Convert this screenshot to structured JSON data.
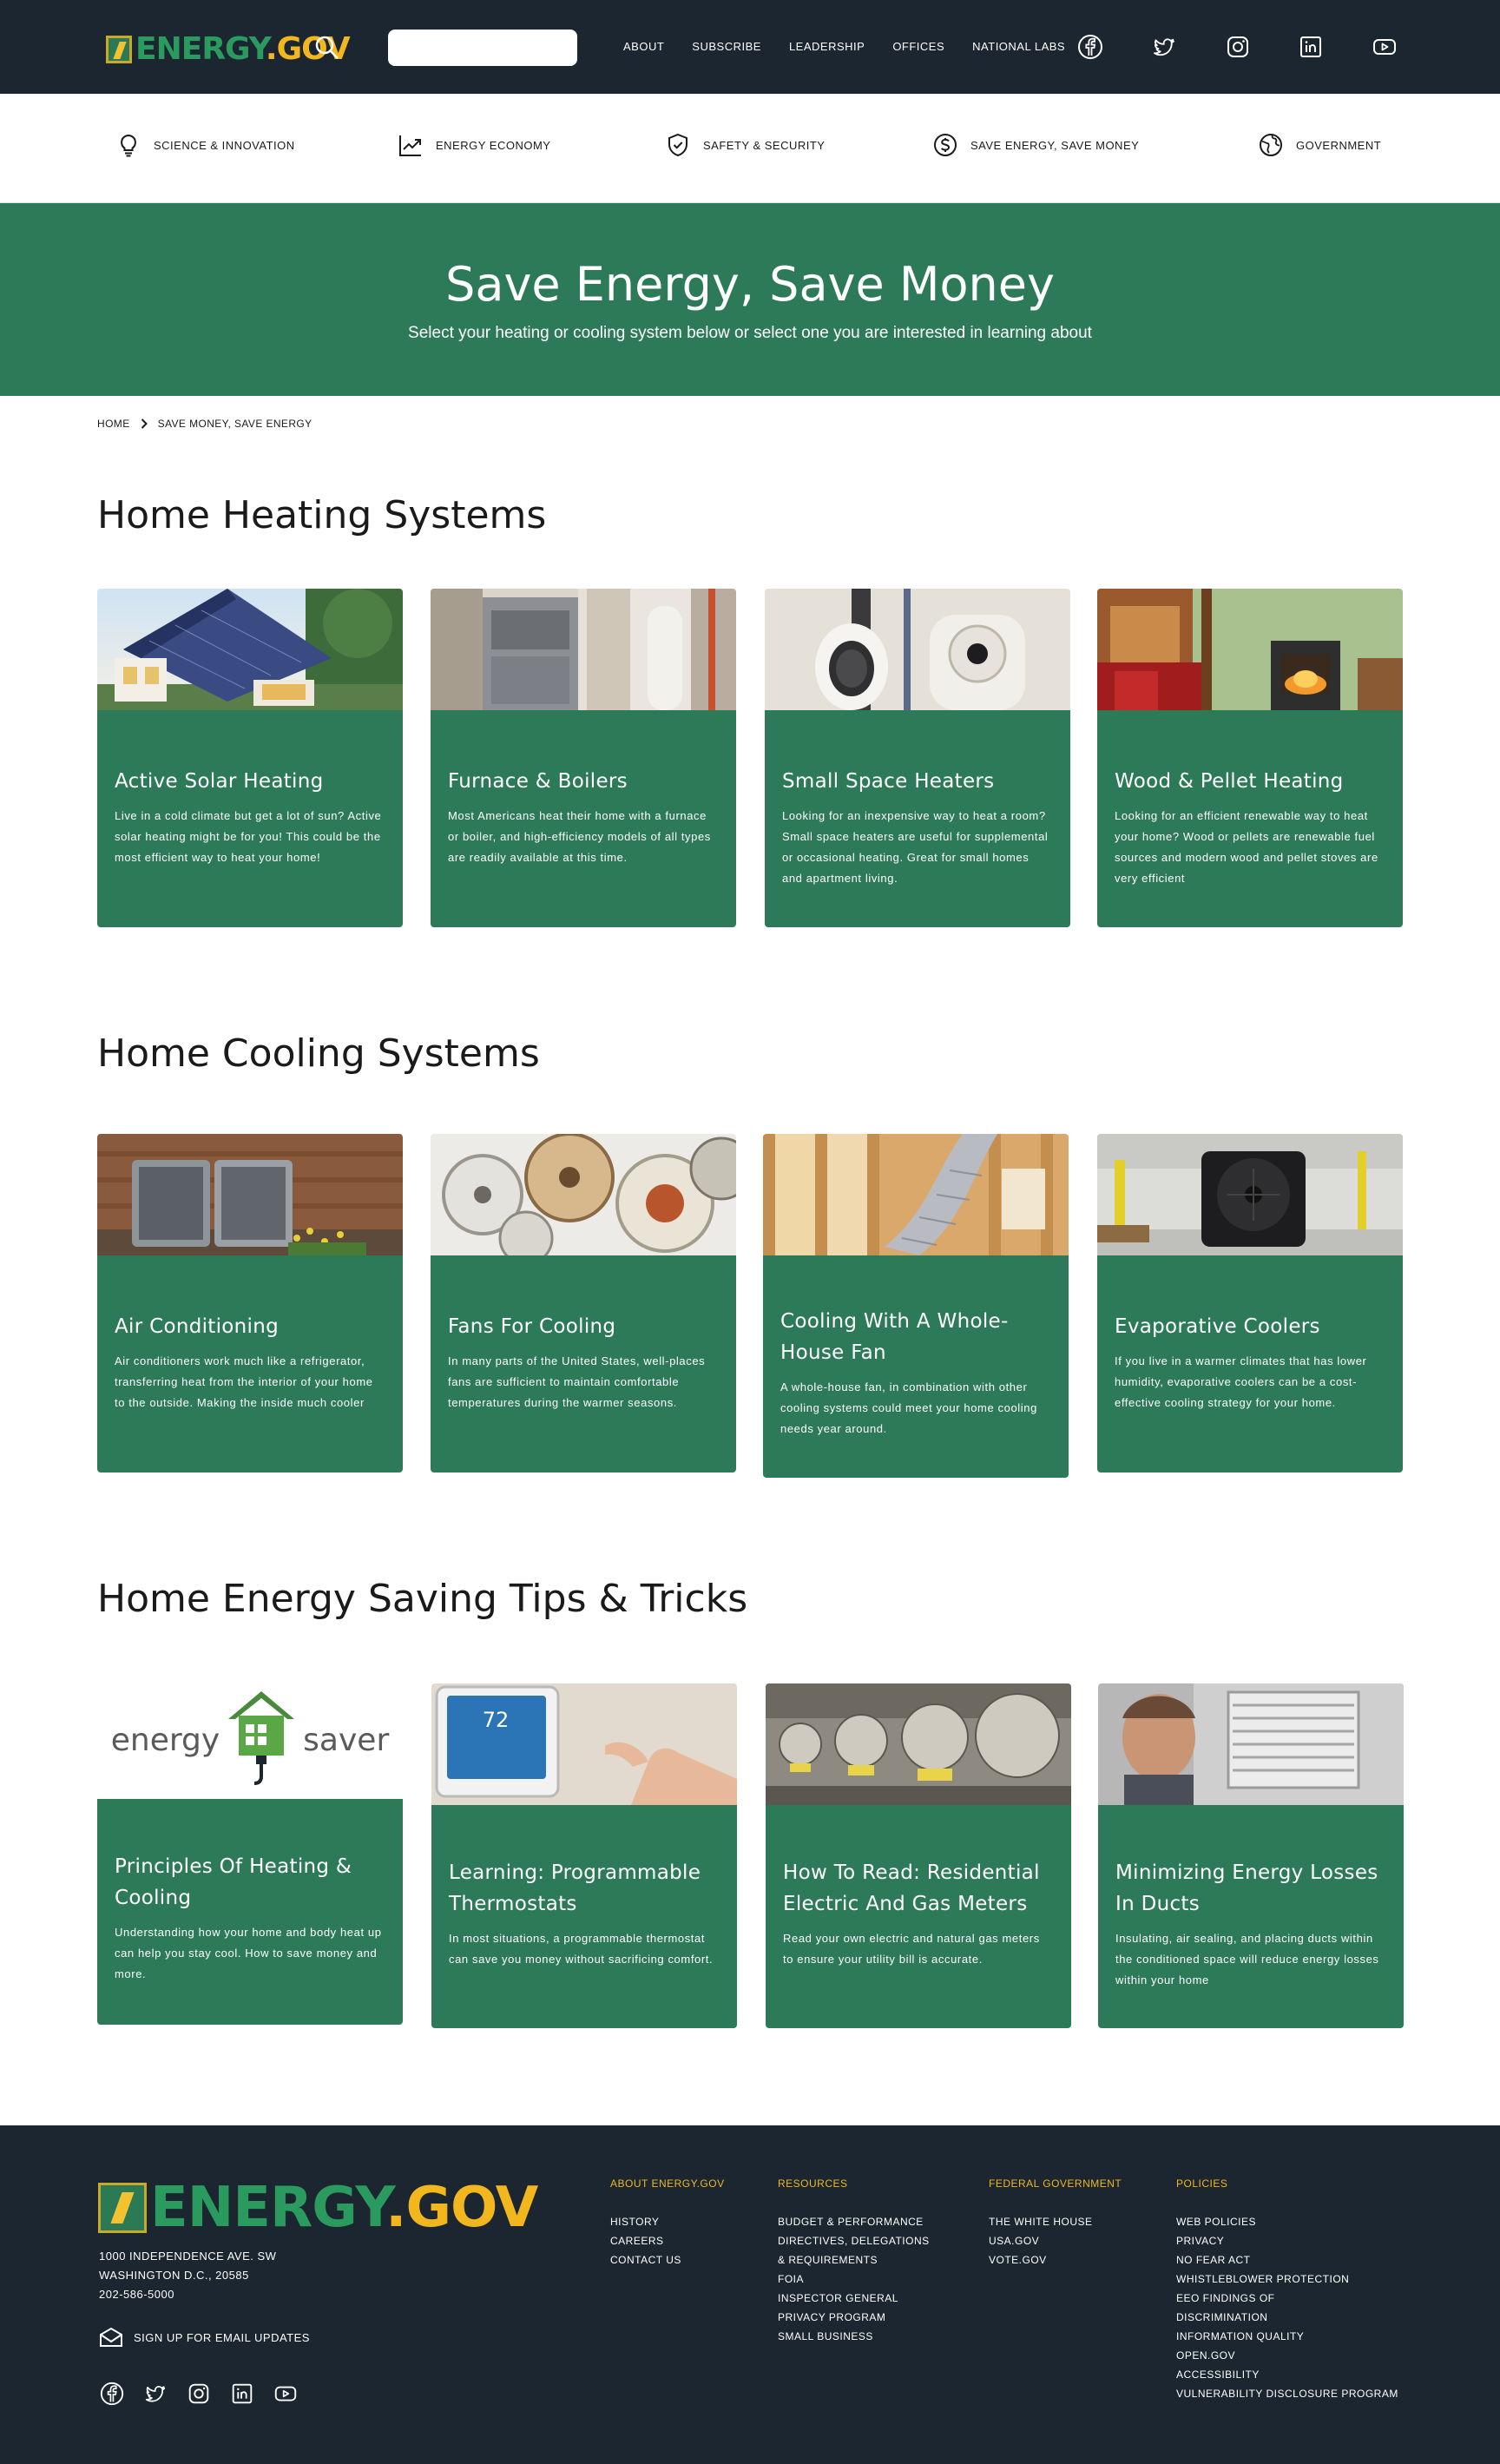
{
  "header": {
    "logo": {
      "energy": "ENERGY",
      "gov": ".GOV"
    },
    "nav": [
      "ABOUT",
      "SUBSCRIBE",
      "LEADERSHIP",
      "OFFICES",
      "NATIONAL LABS"
    ],
    "social_icons": [
      "facebook-icon",
      "twitter-icon",
      "instagram-icon",
      "linkedin-icon",
      "youtube-icon"
    ],
    "search": {
      "placeholder": ""
    }
  },
  "categories": [
    {
      "label": "SCIENCE & INNOVATION",
      "icon": "lightbulb-icon"
    },
    {
      "label": "ENERGY ECONOMY",
      "icon": "chart-line-icon"
    },
    {
      "label": "SAFETY & SECURITY",
      "icon": "shield-check-icon"
    },
    {
      "label": "SAVE ENERGY, SAVE MONEY",
      "icon": "dollar-circle-icon"
    },
    {
      "label": "GOVERNMENT",
      "icon": "globe-icon"
    }
  ],
  "hero": {
    "title": "Save Energy, Save Money",
    "subtitle": "Select your heating or cooling system below or select one you are interested in learning about"
  },
  "breadcrumb": [
    "HOME",
    "SAVE MONEY, SAVE ENERGY"
  ],
  "sections": [
    {
      "title": "Home Heating Systems",
      "cards": [
        {
          "title": "Active Solar Heating",
          "text": "Live in a cold climate but get a lot of sun? Active solar heating might be for you! This could be the most efficient way to heat your home!"
        },
        {
          "title": "Furnace & Boilers",
          "text": "Most Americans heat their home with a furnace or boiler, and high-efficiency models of all types are readily available at this time."
        },
        {
          "title": "Small Space Heaters",
          "text": "Looking for an inexpensive way to heat a room? Small space heaters are useful for supplemental or occasional heating. Great for small homes and apartment living."
        },
        {
          "title": "Wood & Pellet Heating",
          "text": "Looking for an efficient renewable way to heat your home? Wood or pellets are renewable fuel sources and modern wood and pellet stoves are very efficient"
        }
      ]
    },
    {
      "title": "Home Cooling Systems",
      "cards": [
        {
          "title": "Air Conditioning",
          "text": "Air conditioners work much like a refrigerator, transferring heat from the interior of your home to the outside. Making the inside much cooler"
        },
        {
          "title": "Fans For Cooling",
          "text": "In many parts of the United States, well-places fans are sufficient to maintain comfortable temperatures during the warmer seasons."
        },
        {
          "title": "Cooling With A Whole-House Fan",
          "text": "A whole-house fan, in combination with other cooling systems could meet your home cooling needs year around."
        },
        {
          "title": "Evaporative Coolers",
          "text": "If you live in a warmer climates that has lower humidity, evaporative coolers can be a cost-effective cooling strategy for your home."
        }
      ]
    },
    {
      "title": "Home Energy Saving Tips & Tricks",
      "cards": [
        {
          "title": "Principles Of Heating & Cooling",
          "text": "Understanding how your home and body heat up can help you stay cool. How to save money and more."
        },
        {
          "title": "Learning: Programmable Thermostats",
          "text": "In most situations, a programmable thermostat can save you money without sacrificing comfort."
        },
        {
          "title": "How To Read: Residential Electric And Gas Meters",
          "text": "Read your own electric and natural gas meters to ensure your utility bill is accurate."
        },
        {
          "title": "Minimizing Energy Losses In Ducts",
          "text": "Insulating, air sealing, and placing ducts within the conditioned space will reduce energy losses within your home"
        }
      ]
    }
  ],
  "energy_saver_logo": {
    "left": "energy",
    "right": "saver"
  },
  "thermostat_reading": "72",
  "footer": {
    "address": [
      "1000 INDEPENDENCE AVE. SW",
      "WASHINGTON D.C., 20585",
      "202-586-5000"
    ],
    "email_signup": "SIGN UP FOR EMAIL UPDATES",
    "columns": [
      {
        "title": "ABOUT ENERGY.GOV",
        "links": [
          "HISTORY",
          "CAREERS",
          "CONTACT US"
        ]
      },
      {
        "title": "RESOURCES",
        "links": [
          "BUDGET & PERFORMANCE",
          "DIRECTIVES, DELEGATIONS",
          "& REQUIREMENTS",
          "FOIA",
          "INSPECTOR GENERAL",
          "PRIVACY PROGRAM",
          "SMALL BUSINESS"
        ]
      },
      {
        "title": "FEDERAL GOVERNMENT",
        "links": [
          "THE WHITE HOUSE",
          "USA.GOV",
          "VOTE.GOV"
        ]
      },
      {
        "title": "POLICIES",
        "links": [
          "WEB POLICIES",
          "PRIVACY",
          "NO FEAR ACT",
          "WHISTLEBLOWER PROTECTION",
          "EEO FINDINGS OF",
          "DISCRIMINATION",
          "INFORMATION QUALITY",
          "OPEN.GOV",
          "ACCESSIBILITY",
          "VULNERABILITY DISCLOSURE PROGRAM"
        ]
      }
    ]
  },
  "colors": {
    "header_bg": "#1b2630",
    "green": "#2c7a58",
    "gold": "#f2b61f"
  }
}
